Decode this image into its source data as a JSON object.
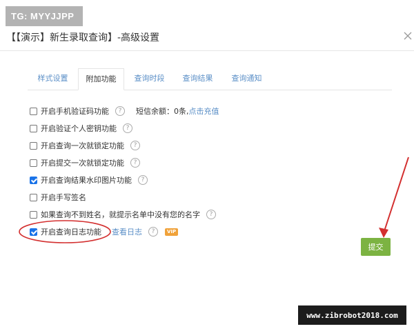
{
  "watermark": "TG: MYYJJPP",
  "dialog": {
    "title": "【【演示】新生录取查询】-高级设置"
  },
  "tabs": [
    {
      "label": "样式设置"
    },
    {
      "label": "附加功能"
    },
    {
      "label": "查询时段"
    },
    {
      "label": "查询结果"
    },
    {
      "label": "查询通知"
    }
  ],
  "active_tab": "附加功能",
  "options": [
    {
      "label": "开启手机验证码功能",
      "checked": false,
      "help": "?",
      "sms_label": "短信余额：0条,",
      "recharge_link": "点击充值"
    },
    {
      "label": "开启验证个人密钥功能",
      "checked": false,
      "help": "?"
    },
    {
      "label": "开启查询一次就锁定功能",
      "checked": false,
      "help": "?"
    },
    {
      "label": "开启提交一次就锁定功能",
      "checked": false,
      "help": "?"
    },
    {
      "label": "开启查询结果水印图片功能",
      "checked": true,
      "help": "?"
    },
    {
      "label": "开启手写签名",
      "checked": false
    },
    {
      "label": "如果查询不到姓名，就提示名单中没有您的名字",
      "checked": false,
      "help": "?"
    },
    {
      "label": "开启查询日志功能",
      "checked": true,
      "help": "?",
      "view_log_link": "查看日志",
      "badge": "VIP"
    }
  ],
  "submit_label": "提交",
  "site_banner": "www.zibrobot2018.com",
  "colors": {
    "link": "#5b8fc7",
    "checkbox_checked": "#1a73e8",
    "submit_bg": "#7cb342",
    "vip_badge": "#f0a23a",
    "annotation_red": "#d32f2f"
  }
}
